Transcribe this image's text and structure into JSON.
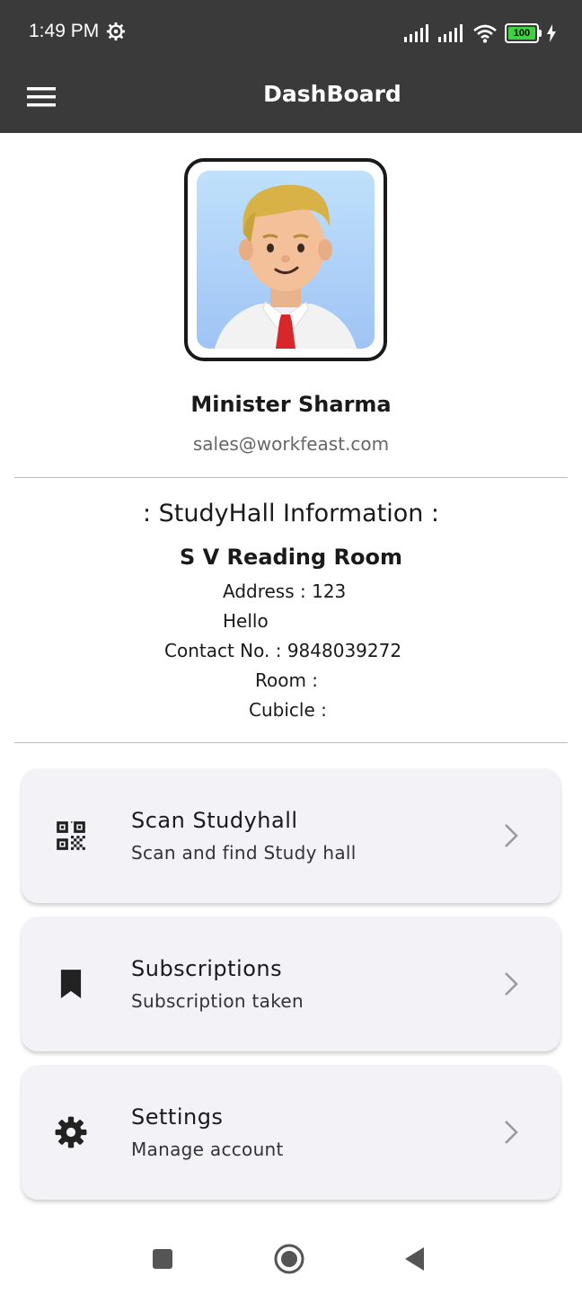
{
  "status_bar": {
    "time": "1:49 PM",
    "battery": "100",
    "icons": [
      "settings-gear-icon",
      "signal-icon",
      "signal-icon",
      "wifi-icon",
      "battery-icon",
      "charging-icon"
    ]
  },
  "app_bar": {
    "title": "DashBoard",
    "menu_icon": "hamburger-menu-icon"
  },
  "profile": {
    "name": "Minister Sharma",
    "email": "sales@workfeast.com"
  },
  "studyhall": {
    "section_title": ": StudyHall Information :",
    "name": "S V Reading Room",
    "address_line1": "Address : 123",
    "address_line2": "Hello",
    "contact": "Contact No. : 9848039272",
    "room": "Room :",
    "cubicle": "Cubicle :"
  },
  "menu_cards": [
    {
      "title": "Scan Studyhall",
      "subtitle": "Scan and find Study hall",
      "icon": "qr-code-icon"
    },
    {
      "title": "Subscriptions",
      "subtitle": "Subscription taken",
      "icon": "bookmark-icon"
    },
    {
      "title": "Settings",
      "subtitle": "Manage account",
      "icon": "settings-icon"
    }
  ],
  "nav_bar": {
    "icons": [
      "recent-apps-icon",
      "home-icon",
      "back-icon"
    ]
  },
  "colors": {
    "app_bar": "#3a3a3a",
    "card_bg": "#f3f2f7",
    "battery": "#3fd43f"
  }
}
